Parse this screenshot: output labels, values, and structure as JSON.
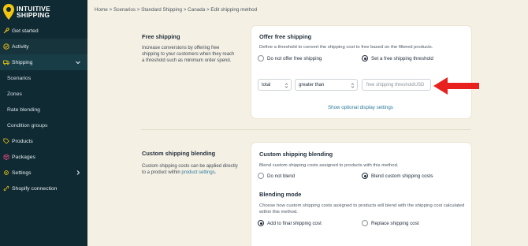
{
  "brand": {
    "line1": "INTUITIVE",
    "line2": "SHIPPING",
    "accent": "#f2c511"
  },
  "sidebar": {
    "items": [
      {
        "label": "Get started",
        "icon": "rocket-icon"
      },
      {
        "label": "Activity",
        "icon": "check-icon"
      },
      {
        "label": "Shipping",
        "icon": "truck-icon"
      },
      {
        "label": "Scenarios"
      },
      {
        "label": "Zones"
      },
      {
        "label": "Rate blending"
      },
      {
        "label": "Condition groups"
      },
      {
        "label": "Products",
        "icon": "tag-icon"
      },
      {
        "label": "Packages",
        "icon": "package-icon"
      },
      {
        "label": "Settings",
        "icon": "gear-icon"
      },
      {
        "label": "Shopify connection",
        "icon": "link-icon"
      }
    ]
  },
  "breadcrumb": "Home > Scenarios > Standard Shipping > Canada > Edit shipping method",
  "free_shipping": {
    "section_title": "Free shipping",
    "section_desc": "Increase conversions by offering free shipping to your customers when they reach a threshold such as minimum order spend.",
    "card_title": "Offer free shipping",
    "card_desc": "Define a threshold to convert the shipping cost to free based on the filtered products.",
    "option_no": "Do not offer free shipping",
    "option_yes": "Set a free shipping threshold",
    "metric_select": "total",
    "operator_select": "greater than",
    "threshold_placeholder": "free shipping threshold",
    "threshold_unit": "USD",
    "show_link": "Show optional display settings"
  },
  "blending": {
    "section_title": "Custom shipping blending",
    "section_desc_prefix": "Custom shipping costs can be applied directly to a product within ",
    "section_desc_link": "product settings",
    "section_desc_suffix": ".",
    "card_title": "Custom shipping blending",
    "card_desc": "Blend custom shipping costs assigned to products with this method.",
    "option_no": "Do not blend",
    "option_yes": "Blend custom shipping costs",
    "mode_title": "Blending mode",
    "mode_desc": "Choose how custom shipping costs assigned to products will blend with the shipping cost calculated within this method.",
    "mode_add": "Add to final shipping cost",
    "mode_replace": "Replace shipping cost"
  }
}
